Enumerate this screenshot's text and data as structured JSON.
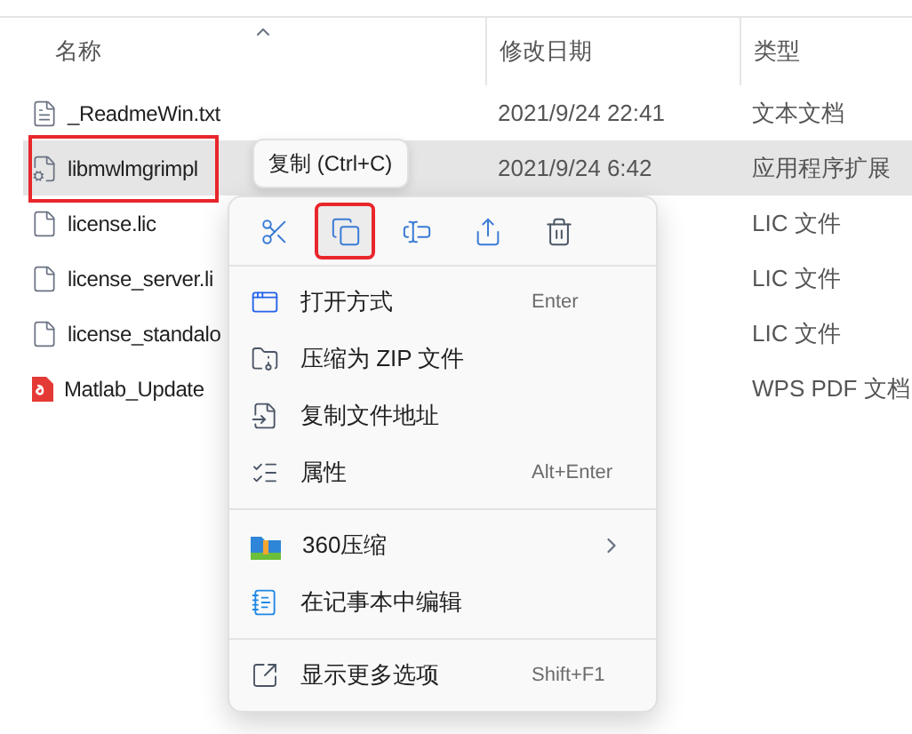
{
  "columns": [
    {
      "label": "名称",
      "sorted": true
    },
    {
      "label": "修改日期",
      "sorted": false
    },
    {
      "label": "类型",
      "sorted": false
    }
  ],
  "files": [
    {
      "name": "_ReadmeWin.txt",
      "date": "2021/9/24 22:41",
      "type": "文本文档",
      "kind": "text",
      "selected": false,
      "highlighted": false
    },
    {
      "name": "libmwlmgrimpl",
      "date": "2021/9/24 6:42",
      "type": "应用程序扩展",
      "kind": "dll",
      "selected": true,
      "highlighted": true
    },
    {
      "name": "license.lic",
      "type": "LIC 文件",
      "kind": "lic",
      "selected": false,
      "highlighted": false
    },
    {
      "name": "license_server.li",
      "type": "LIC 文件",
      "kind": "lic",
      "selected": false,
      "highlighted": false
    },
    {
      "name": "license_standalo",
      "type": "LIC 文件",
      "kind": "lic",
      "selected": false,
      "highlighted": false
    },
    {
      "name": "Matlab_Update",
      "type": "WPS PDF 文档",
      "kind": "pdf",
      "selected": false,
      "highlighted": false
    }
  ],
  "context_menu": {
    "tooltip": "复制 (Ctrl+C)",
    "toolbar": [
      {
        "kind": "cut",
        "highlighted": false
      },
      {
        "kind": "copy",
        "highlighted": true
      },
      {
        "kind": "rename",
        "highlighted": false
      },
      {
        "kind": "share",
        "highlighted": false
      },
      {
        "kind": "delete",
        "highlighted": false
      }
    ],
    "groups": [
      [
        {
          "kind": "open-with",
          "label": "打开方式",
          "shortcut": "Enter",
          "submenu": false
        },
        {
          "kind": "zip",
          "label": "压缩为 ZIP 文件",
          "submenu": false
        },
        {
          "kind": "copy-path",
          "label": "复制文件地址",
          "submenu": false
        },
        {
          "kind": "properties",
          "label": "属性",
          "shortcut": "Alt+Enter",
          "submenu": false
        }
      ],
      [
        {
          "kind": "archiver",
          "label": "360压缩",
          "submenu": true
        },
        {
          "kind": "notepad",
          "label": "在记事本中编辑",
          "submenu": false
        }
      ],
      [
        {
          "kind": "more",
          "label": "显示更多选项",
          "shortcut": "Shift+F1",
          "submenu": false
        }
      ]
    ]
  }
}
